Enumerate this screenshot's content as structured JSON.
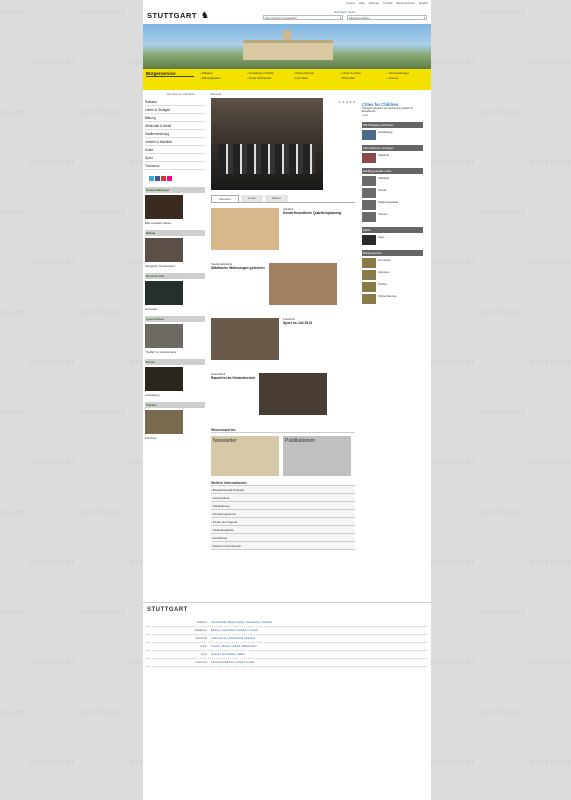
{
  "bg_watermark": "STUTTGART",
  "topnav": [
    "Presse",
    "Hilfe",
    "Sitemap",
    "Kontakt",
    "Barrierefreiheit",
    "English"
  ],
  "header": {
    "logo": "STUTTGART",
    "search_label": "Erweiterte Suche",
    "select1": "Kein Angebot ausgewählt",
    "select2": "Stuttgart erleben"
  },
  "yellowbar": {
    "title": "Bürgerservice",
    "cols": [
      [
        "Rathaus",
        "Öffnungszeiten"
      ],
      [
        "Verwaltung & Politik",
        "Ämter & Behörden"
      ],
      [
        "Online-Dienste",
        "Formulare"
      ],
      [
        "Leben & Arbeit",
        "Wirtschaft"
      ],
      [
        "Veranstaltungen",
        "Freizeit"
      ]
    ]
  },
  "breadcrumb": {
    "left": "Die Seite im Überblick",
    "main": "Startseite"
  },
  "lnav": [
    "Rathaus",
    "Leben in Stuttgart",
    "Bildung",
    "Wirtschaft & Arbeit",
    "Stadtentwicklung",
    "Verkehr & Mobilität",
    "Kultur",
    "Sport",
    "Tourismus"
  ],
  "lboxes": [
    {
      "h": "Veranstaltungen",
      "t": "Bitte Auswahl wählen"
    },
    {
      "h": "Bühne",
      "t": "Stuttgarter Theaterleben"
    },
    {
      "h": "Konzertreihe",
      "t": "Orchester"
    },
    {
      "h": "Lesezeichen",
      "t": "\"Vielfalt\" im Literaturhaus"
    },
    {
      "h": "Kunst",
      "t": "Ausstellung"
    },
    {
      "h": "Theater",
      "t": "Premiere"
    }
  ],
  "main": {
    "cities_title": "Cities for Children",
    "cities_text": "Stuttgart gewinnt den European Award of Excellence",
    "more": "mehr",
    "pager": [
      "1",
      "2",
      "3",
      "4",
      "5"
    ],
    "tabs": [
      "Aktuelles",
      "Fotos",
      "Videos"
    ],
    "news": [
      {
        "h": "Kinderfreundliche Quartiersplanung",
        "t": "Stadtteil"
      },
      {
        "h": "Städtische Wohnungen gesichert",
        "t": "Stadtentwicklung"
      },
      {
        "h": "Sport im Juli 2013",
        "t": "Kulturamt"
      },
      {
        "h": "Rauchfrei im Kinderbereich",
        "t": "Gesundheit"
      }
    ],
    "wissen_h": "Wissenswertes",
    "cards": [
      "Newsletter",
      "Publikationen"
    ],
    "links_h": "Weitere Informationen",
    "links": [
      "Bürgerhaushalt Stuttgart",
      "Gemeinderat",
      "Stadtplanung",
      "Förderprogramme",
      "Kinder und Jugend",
      "Stellenangebote",
      "Ausbildung",
      "Weitere Informationen"
    ]
  },
  "rcol": {
    "boxes": [
      {
        "h": "OB Wolfgang Schuster",
        "items": [
          "Gastbeitrag"
        ]
      },
      {
        "h": "Informationen Stuttgart",
        "items": [
          "Stadtinfo"
        ]
      },
      {
        "h": "Häufig gestellte Links",
        "items": [
          "Stadtwiki",
          "Presse",
          "Stellenangebote",
          "Vereine"
        ]
      },
      {
        "h": "Mobil",
        "items": [
          "Apps"
        ]
      },
      {
        "h": "Bürgerservice",
        "items": [
          "Formulare",
          "Adressen",
          "Telefon",
          "Online-Dienste"
        ]
      }
    ]
  },
  "footer": {
    "logo": "STUTTGART",
    "rows": [
      [
        "Rathaus",
        "Gemeinderat | Bürgermeister | Verwaltung | Haushalt"
      ],
      [
        "Stadtleben",
        "Bildung | Gesundheit | Soziales | Umwelt"
      ],
      [
        "Wirtschaft",
        "Unternehmen | Arbeitsmarkt | Standort"
      ],
      [
        "Kultur",
        "Theater | Museen | Musik | Bibliotheken"
      ],
      [
        "Sport",
        "Vereine | Sportstätten | Bäder"
      ],
      [
        "Tourismus",
        "Sehenswürdigkeiten | Hotels | Anreise"
      ]
    ]
  }
}
